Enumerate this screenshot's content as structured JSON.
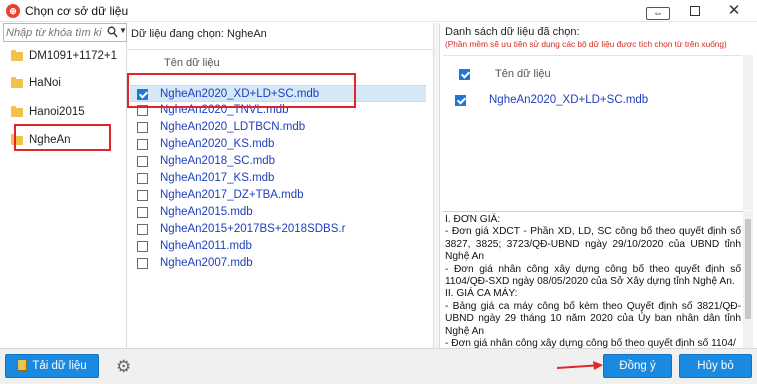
{
  "window": {
    "title": "Chọn cơ sở dữ liệu",
    "close_glyph": "✕"
  },
  "left": {
    "search_placeholder": "Nhập từ khóa tìm kiếm",
    "folders": [
      {
        "label": "DM1091+1172+1",
        "icon": "folder-icon"
      },
      {
        "label": "HaNoi",
        "icon": "folder-icon"
      },
      {
        "label": "Hanoi2015",
        "icon": "folder-icon"
      },
      {
        "label": "NgheAn",
        "icon": "folder-icon"
      }
    ]
  },
  "middle": {
    "header": "Dữ liệu đang chọn: NgheAn",
    "column_header": "Tên dữ liệu",
    "files": [
      {
        "label": "NgheAn2020_XD+LD+SC.mdb",
        "checked": true
      },
      {
        "label": "NgheAn2020_TNVL.mdb",
        "checked": false
      },
      {
        "label": "NgheAn2020_LDTBCN.mdb",
        "checked": false
      },
      {
        "label": "NgheAn2020_KS.mdb",
        "checked": false
      },
      {
        "label": "NgheAn2018_SC.mdb",
        "checked": false
      },
      {
        "label": "NgheAn2017_KS.mdb",
        "checked": false
      },
      {
        "label": "NgheAn2017_DZ+TBA.mdb",
        "checked": false
      },
      {
        "label": "NgheAn2015.mdb",
        "checked": false
      },
      {
        "label": "NgheAn2015+2017BS+2018SDBS.r",
        "checked": false
      },
      {
        "label": "NgheAn2011.mdb",
        "checked": false
      },
      {
        "label": "NgheAn2007.mdb",
        "checked": false
      }
    ]
  },
  "right": {
    "title": "Danh sách dữ liệu đã chọn:",
    "note": "(Phần mềm sẽ ưu tiên sử dụng các bộ dữ liệu được tích chọn từ trên xuống)",
    "column_header": "Tên dữ liệu",
    "selected": [
      {
        "label": "NgheAn2020_XD+LD+SC.mdb",
        "checked": true
      }
    ],
    "notes": [
      "I. ĐƠN GIÁ:",
      "- Đơn giá XDCT - Phần XD, LD, SC công bố theo quyết định số 3827, 3825; 3723/QĐ-UBND ngày 29/10/2020 của UBND tỉnh Nghệ An",
      "- Đơn giá nhân công xây dựng công bố theo quyết định số 1104/QĐ-SXD ngày 08/05/2020 của Sở Xây dựng tỉnh Nghệ An.",
      "II. GIÁ CA MÁY:",
      "- Bảng giá ca máy công bố kèm theo Quyết định số 3821/QĐ-UBND ngày 29 tháng 10 năm 2020 của Ủy ban nhân dân tỉnh Nghệ An",
      "- Đơn giá nhân công xây dựng công bố theo quyết định số 1104/"
    ]
  },
  "bottom": {
    "load_label": "Tải dữ liệu",
    "ok_label": "Đồng ý",
    "cancel_label": "Hủy bỏ"
  },
  "colors": {
    "accent": "#1a8ae0",
    "highlight": "#e0262c",
    "link": "#1d3fbe"
  }
}
